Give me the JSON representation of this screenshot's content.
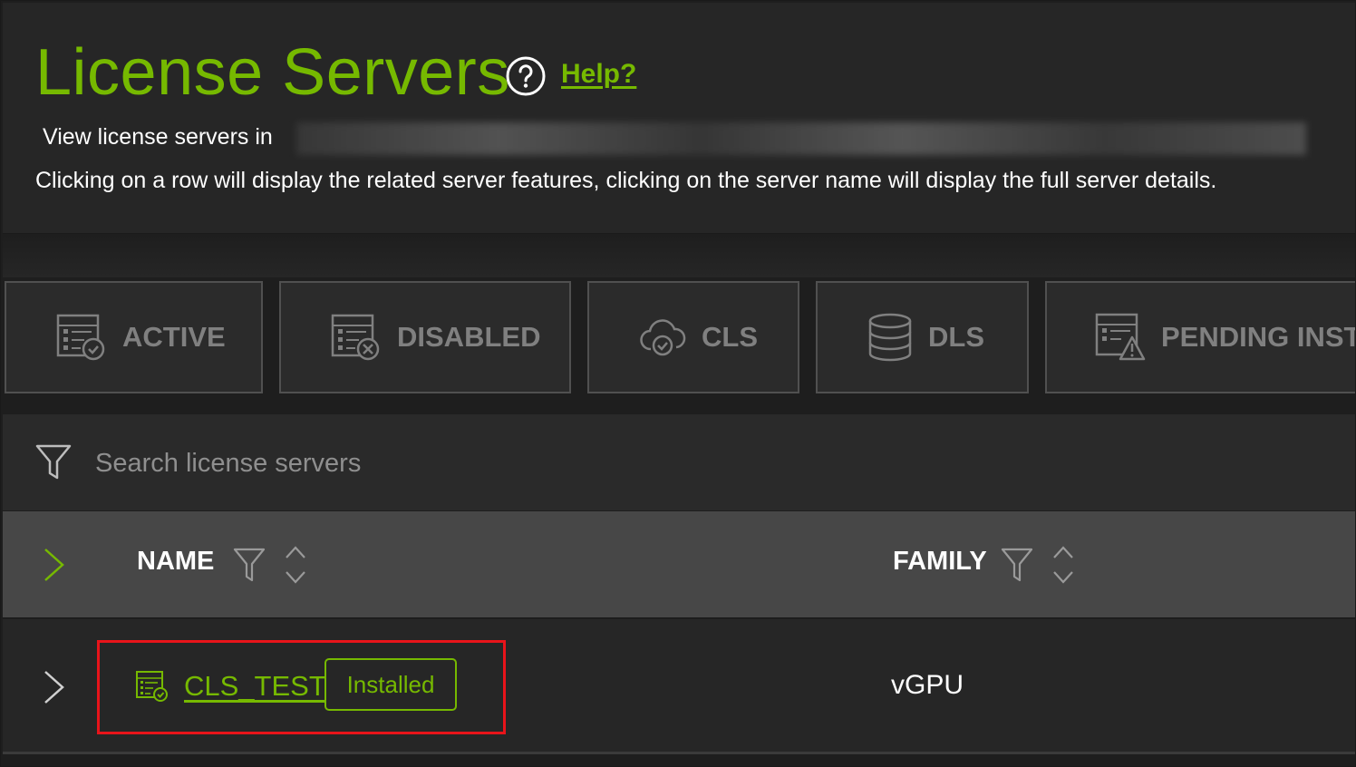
{
  "header": {
    "title": "License Servers",
    "help_label": "Help?",
    "view_in_text": "View license servers in",
    "instructions": "Clicking on a row will display the related server features, clicking on the server name will display the full server details."
  },
  "tiles": [
    {
      "label": "ACTIVE",
      "icon": "server-list-check-icon"
    },
    {
      "label": "DISABLED",
      "icon": "server-list-x-icon"
    },
    {
      "label": "CLS",
      "icon": "cloud-check-icon"
    },
    {
      "label": "DLS",
      "icon": "database-icon"
    },
    {
      "label": "PENDING INSTA",
      "icon": "server-list-warning-icon"
    }
  ],
  "search": {
    "placeholder": "Search license servers"
  },
  "table": {
    "columns": [
      "NAME",
      "FAMILY"
    ],
    "rows": [
      {
        "name": "CLS_TEST",
        "status": "Installed",
        "family": "vGPU"
      }
    ]
  },
  "colors": {
    "accent": "#76b900",
    "highlight": "#e8141a",
    "background": "#1e1e1e",
    "header_row": "#474747"
  }
}
